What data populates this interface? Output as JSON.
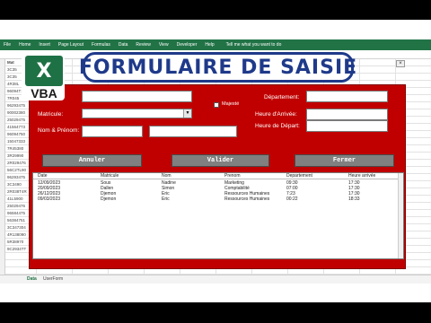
{
  "ribbon": {
    "items": [
      "File",
      "Home",
      "Insert",
      "Page Layout",
      "Formulas",
      "Data",
      "Review",
      "View",
      "Developer",
      "Help"
    ],
    "tell_me": "Tell me what you want to do"
  },
  "sheet": {
    "col_header": "Mat",
    "col_values": [
      "3C35",
      "3C35",
      "4R38L",
      "96094T1",
      "7R045",
      "96293475",
      "90002380",
      "25029475",
      "41564773",
      "96094750",
      "15047333",
      "7R45380",
      "3R29990",
      "2R029476",
      "56C2TL90",
      "96293475",
      "3C3490",
      "2R038T4R",
      "41L5900",
      "25029476",
      "96584475",
      "56384751",
      "3C347304",
      "4R138090",
      "5R38970",
      "9C2934TT"
    ],
    "tabs": [
      "Data",
      "UserForm"
    ]
  },
  "logo": {
    "letter": "X",
    "label": "VBA"
  },
  "title": "FORMULAIRE DE SAISIE",
  "form": {
    "labels": {
      "matricule": "Matricule:",
      "nom_prenom": "Nom & Prénom:",
      "majeste": "Majesté",
      "departement": "Département:",
      "heure_arrivee": "Heure d'Arrivée:",
      "heure_depart": "Heure de Départ:"
    },
    "buttons": {
      "annuler": "Annuler",
      "valider": "Valider",
      "fermer": "Fermer"
    }
  },
  "list": {
    "columns": [
      "Date",
      "Matricule",
      "Nom",
      "Prenom",
      "Departement",
      "Heure arrivée"
    ],
    "rows": [
      [
        "12/09/2023",
        "Sous",
        "Nadine",
        "Marketing",
        "09:30",
        "17:30"
      ],
      [
        "20/09/2023",
        "Dallen",
        "Simon",
        "Comptabilité",
        "07:00",
        "17:30"
      ],
      [
        "26/12/2023",
        "Djemon",
        "Eric",
        "Ressources Humaines",
        "7:23",
        "17:30"
      ],
      [
        "09/03/2023",
        "Djemon",
        "Eric",
        "Ressources Humaines",
        "00:22",
        "18:33"
      ]
    ]
  }
}
